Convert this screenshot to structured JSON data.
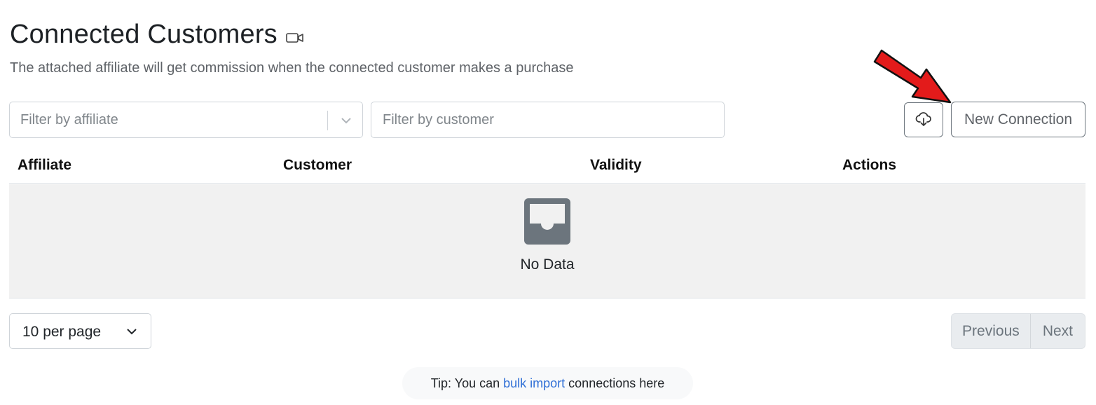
{
  "header": {
    "title": "Connected Customers",
    "subtitle": "The attached affiliate will get commission when the connected customer makes a purchase"
  },
  "filters": {
    "affiliate_placeholder": "Filter by affiliate",
    "customer_placeholder": "Filter by customer"
  },
  "toolbar": {
    "new_connection_label": "New Connection",
    "download_icon": "cloud-download-icon"
  },
  "table": {
    "columns": [
      "Affiliate",
      "Customer",
      "Validity",
      "Actions"
    ],
    "empty_text": "No Data",
    "empty_icon": "inbox-icon"
  },
  "pagination": {
    "per_page": "10 per page",
    "previous_label": "Previous",
    "next_label": "Next"
  },
  "tip": {
    "prefix": "Tip: You can ",
    "link": "bulk import",
    "suffix": " connections here"
  },
  "colors": {
    "annotation_arrow": "#e31b1b",
    "link": "#2f6fd6",
    "empty_bg": "#f1f1f1"
  }
}
